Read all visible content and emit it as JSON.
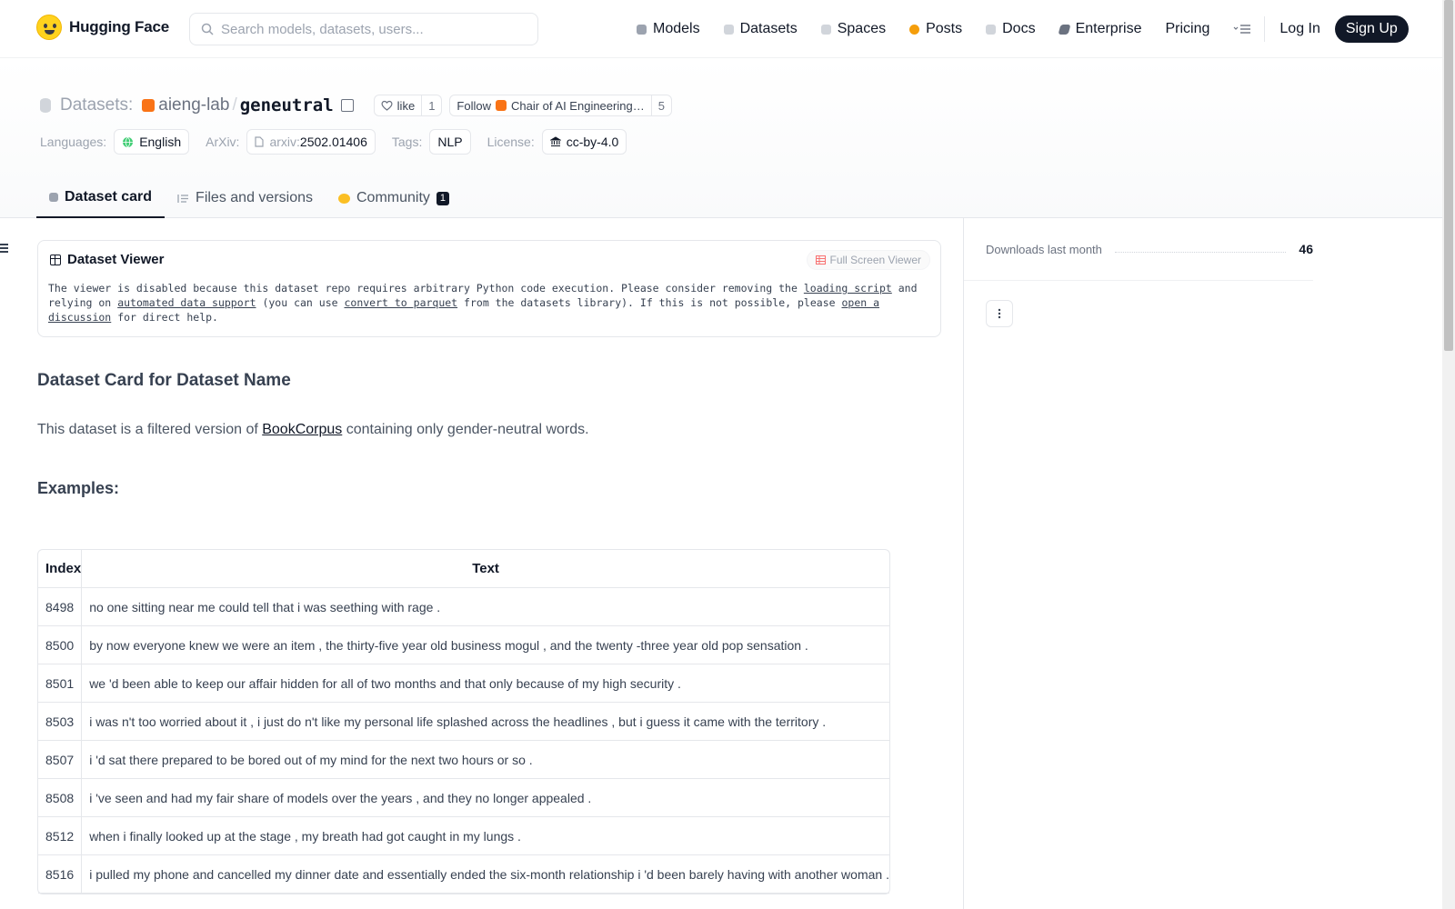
{
  "nav": {
    "brand": "Hugging Face",
    "search_placeholder": "Search models, datasets, users...",
    "links": [
      {
        "label": "Models",
        "color": "#9ca3af"
      },
      {
        "label": "Datasets",
        "color": "#d1d5db"
      },
      {
        "label": "Spaces",
        "color": "#d1d5db"
      },
      {
        "label": "Posts",
        "color": "#f59e0b"
      },
      {
        "label": "Docs",
        "color": "#d1d5db"
      },
      {
        "label": "Enterprise",
        "color": "#6b7280"
      },
      {
        "label": "Pricing"
      }
    ],
    "login": "Log In",
    "signup": "Sign Up"
  },
  "header": {
    "section": "Datasets:",
    "org": "aieng-lab",
    "name": "geneutral",
    "like_label": "like",
    "like_count": "1",
    "follow_label": "Follow",
    "follow_org": "Chair of AI Engineering…",
    "follow_count": "5",
    "languages_label": "Languages:",
    "language": "English",
    "arxiv_label": "ArXiv:",
    "arxiv_prefix": "arxiv:",
    "arxiv_id": "2502.01406",
    "tags_label": "Tags:",
    "tag": "NLP",
    "license_label": "License:",
    "license": "cc-by-4.0"
  },
  "tabs": [
    {
      "label": "Dataset card"
    },
    {
      "label": "Files and versions"
    },
    {
      "label": "Community",
      "badge": "1"
    }
  ],
  "viewer": {
    "title": "Dataset Viewer",
    "fullscreen": "Full Screen Viewer",
    "msg_1": "The viewer is disabled because this dataset repo requires arbitrary Python code execution. Please consider removing the",
    "link_loading": "loading script",
    "msg_2": "and relying on",
    "link_auto": "automated data support",
    "msg_3": "(you can use",
    "link_convert": "convert to parquet",
    "msg_4": "from the datasets library). If this is not possible, please",
    "link_discussion": "open a discussion",
    "msg_5": "for direct help."
  },
  "card": {
    "heading": "Dataset Card for Dataset Name",
    "intro_1": "This dataset is a filtered version of",
    "intro_link": "BookCorpus",
    "intro_2": "containing only gender-neutral words.",
    "examples_heading": "Examples:",
    "table": {
      "headers": [
        "Index",
        "Text"
      ],
      "rows": [
        [
          "8498",
          "no one sitting near me could tell that i was seething with rage ."
        ],
        [
          "8500",
          "by now everyone knew we were an item , the thirty-five year old business mogul , and the twenty -three year old pop sensation ."
        ],
        [
          "8501",
          "we 'd been able to keep our affair hidden for all of two months and that only because of my high security ."
        ],
        [
          "8503",
          "i was n't too worried about it , i just do n't like my personal life splashed across the headlines , but i guess it came with the territory ."
        ],
        [
          "8507",
          "i 'd sat there prepared to be bored out of my mind for the next two hours or so ."
        ],
        [
          "8508",
          "i 've seen and had my fair share of models over the years , and they no longer appealed ."
        ],
        [
          "8512",
          "when i finally looked up at the stage , my breath had got caught in my lungs ."
        ],
        [
          "8516",
          "i pulled my phone and cancelled my dinner date and essentially ended the six-month relationship i 'd been barely having with another woman ."
        ]
      ]
    }
  },
  "sidebar": {
    "downloads_label": "Downloads last month",
    "downloads_count": "46"
  }
}
